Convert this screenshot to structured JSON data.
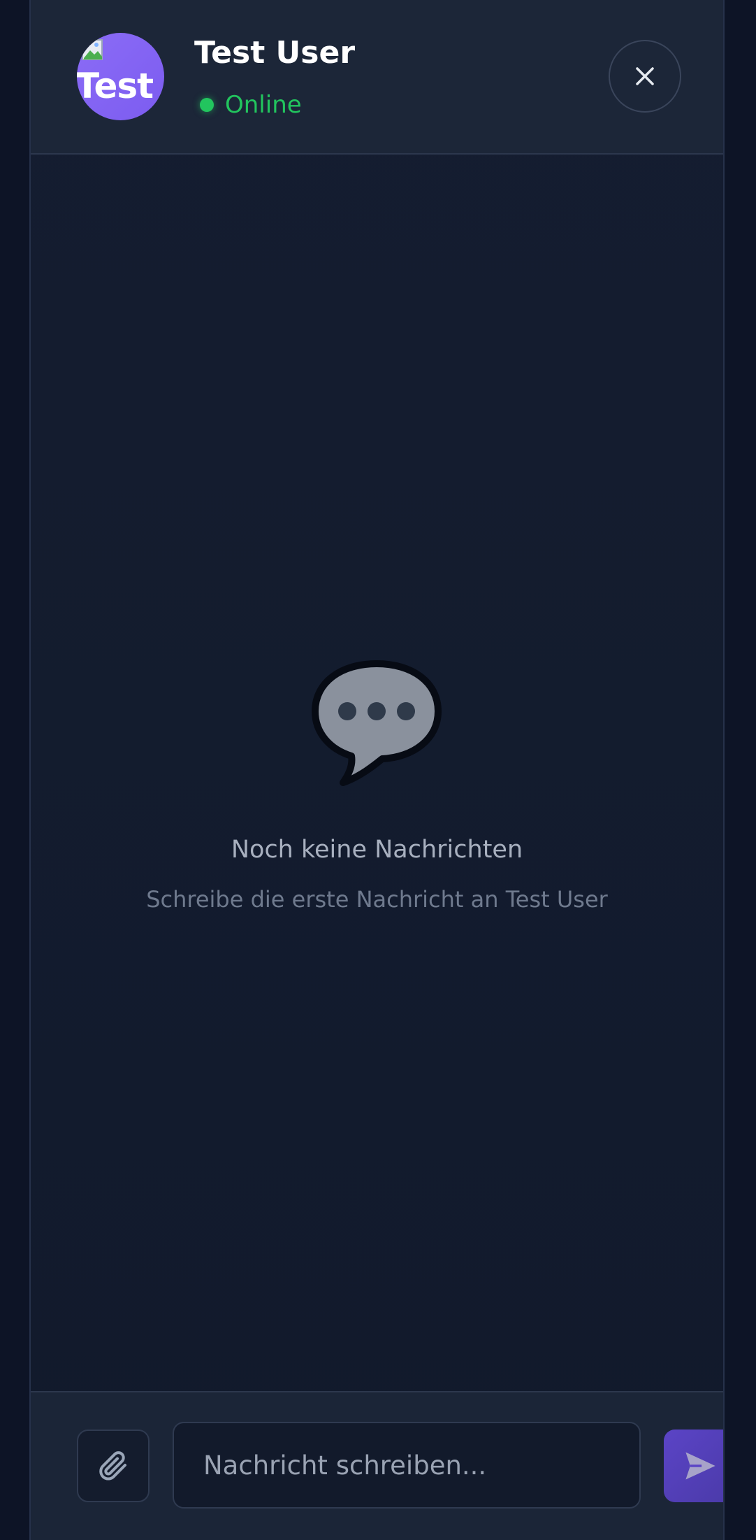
{
  "header": {
    "avatar_alt": "Test",
    "contact_name": "Test User",
    "status": "Online"
  },
  "empty_state": {
    "title": "Noch keine Nachrichten",
    "subtitle": "Schreibe die erste Nachricht an Test User"
  },
  "composer": {
    "input_value": "",
    "input_placeholder": "Nachricht schreiben..."
  },
  "icons": {
    "close": "close-icon",
    "attach": "paperclip-icon",
    "send": "send-icon",
    "empty": "speech-bubble-icon",
    "avatar_broken": "broken-image-icon"
  },
  "colors": {
    "accent": "#7c5cf0",
    "online": "#22c55e",
    "background": "#111a2c"
  }
}
